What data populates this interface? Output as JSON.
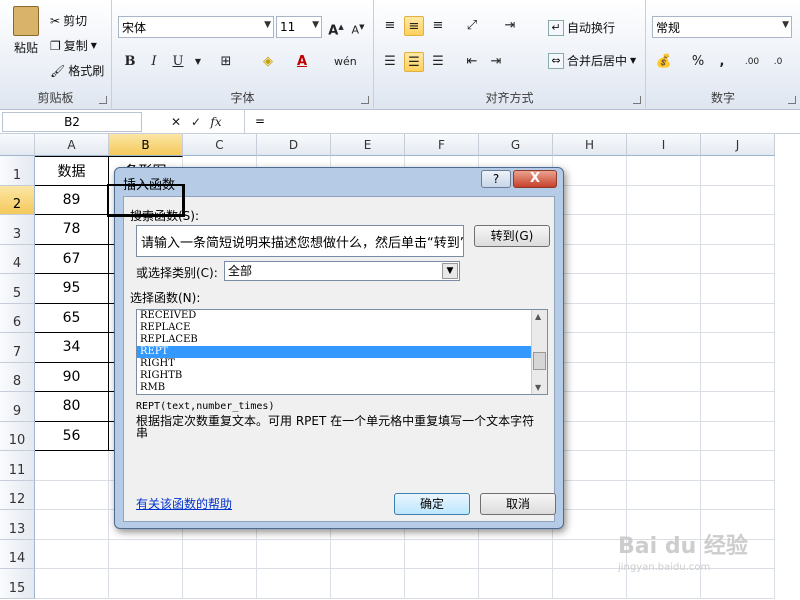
{
  "ribbon": {
    "clipboard": {
      "label": "剪贴板",
      "paste": "粘贴",
      "cut": "剪切",
      "copy": "复制",
      "format_painter": "格式刷"
    },
    "font": {
      "label": "字体",
      "name": "宋体",
      "size": "11",
      "bold": "B",
      "italic": "I",
      "underline": "U"
    },
    "alignment": {
      "label": "对齐方式",
      "wrap_text": "自动换行",
      "merge_center": "合并后居中"
    },
    "number": {
      "label": "数字",
      "format": "常规",
      "percent": "%",
      "comma": ","
    }
  },
  "formula_bar": {
    "name_box": "B2",
    "formula": "=",
    "fx": "fx"
  },
  "grid": {
    "columns": [
      "A",
      "B",
      "C",
      "D",
      "E",
      "F",
      "G",
      "H",
      "I",
      "J"
    ],
    "rows": [
      "1",
      "2",
      "3",
      "4",
      "5",
      "6",
      "7",
      "8",
      "9",
      "10",
      "11",
      "12",
      "13",
      "14",
      "15"
    ],
    "a_values": [
      "数据",
      "89",
      "78",
      "67",
      "95",
      "65",
      "34",
      "90",
      "80",
      "56"
    ],
    "b1": "条形图"
  },
  "dialog": {
    "title": "插入函数",
    "help": "?",
    "close": "X",
    "search_label": "搜索函数(S):",
    "search_value": "请输入一条简短说明来描述您想做什么，然后单击“转到”",
    "go_button": "转到(G)",
    "category_label": "或选择类别(C):",
    "category_value": "全部",
    "select_label": "选择函数(N):",
    "functions": [
      "RECEIVED",
      "REPLACE",
      "REPLACEB",
      "REPT",
      "RIGHT",
      "RIGHTB",
      "RMB"
    ],
    "selected_index": 3,
    "signature": "REPT(text,number_times)",
    "description": "根据指定次数重复文本。可用 RPET 在一个单元格中重复填写一个文本字符串",
    "help_link": "有关该函数的帮助",
    "ok": "确定",
    "cancel": "取消"
  },
  "watermark": {
    "main": "Bai du 经验",
    "sub": "jingyan.baidu.com"
  }
}
